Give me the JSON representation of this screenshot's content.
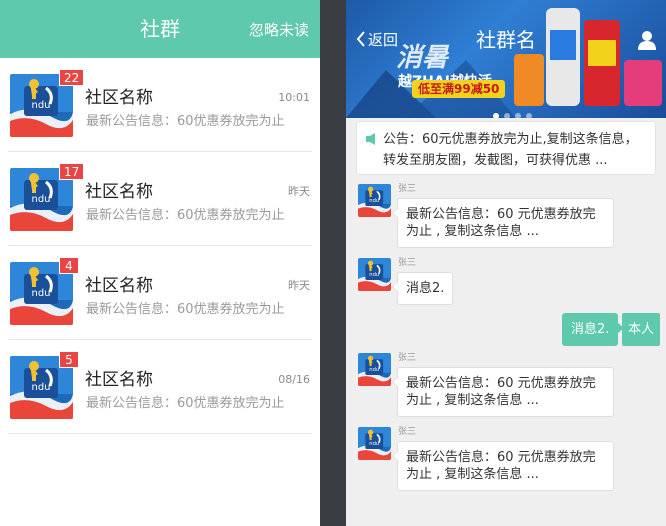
{
  "left": {
    "title": "社群",
    "ignore_unread": "忽略未读",
    "conversations": [
      {
        "name": "社区名称",
        "preview": "最新公告信息：60优惠券放完为止",
        "time": "10:01",
        "badge": "22"
      },
      {
        "name": "社区名称",
        "preview": "最新公告信息：60优惠券放完为止",
        "time": "昨天",
        "badge": "17"
      },
      {
        "name": "社区名称",
        "preview": "最新公告信息：60优惠券放完为止",
        "time": "昨天",
        "badge": "4"
      },
      {
        "name": "社区名称",
        "preview": "最新公告信息：60优惠券放完为止",
        "time": "08/16",
        "badge": "5"
      }
    ]
  },
  "right": {
    "back_label": "返回",
    "title": "社群名",
    "banner": {
      "slogan": "越ZHAI越快活",
      "promo": "低至满99减50"
    },
    "notice": "公告：60元优惠券放完为止,复制这条信息，转发至朋友圈，发截图，可获得优惠 ...",
    "messages": [
      {
        "sender": "张三",
        "text": "最新公告信息：60 元优惠券放完为止 , 复制这条信息 ..."
      },
      {
        "sender": "张三",
        "text": "消息2."
      },
      {
        "self_text": "消息2.",
        "self_label": "本人"
      },
      {
        "sender": "张三",
        "text": "最新公告信息：60 元优惠券放完为止 , 复制这条信息 ..."
      },
      {
        "sender": "张三",
        "text": "最新公告信息：60 元优惠券放完为止 , 复制这条信息 ..."
      }
    ]
  },
  "colors": {
    "accent": "#5ec9ad",
    "badge": "#e84545",
    "background": "#3a3d42"
  },
  "icons": [
    "back-chevron-icon",
    "user-icon",
    "speaker-icon",
    "community-avatar-icon"
  ]
}
